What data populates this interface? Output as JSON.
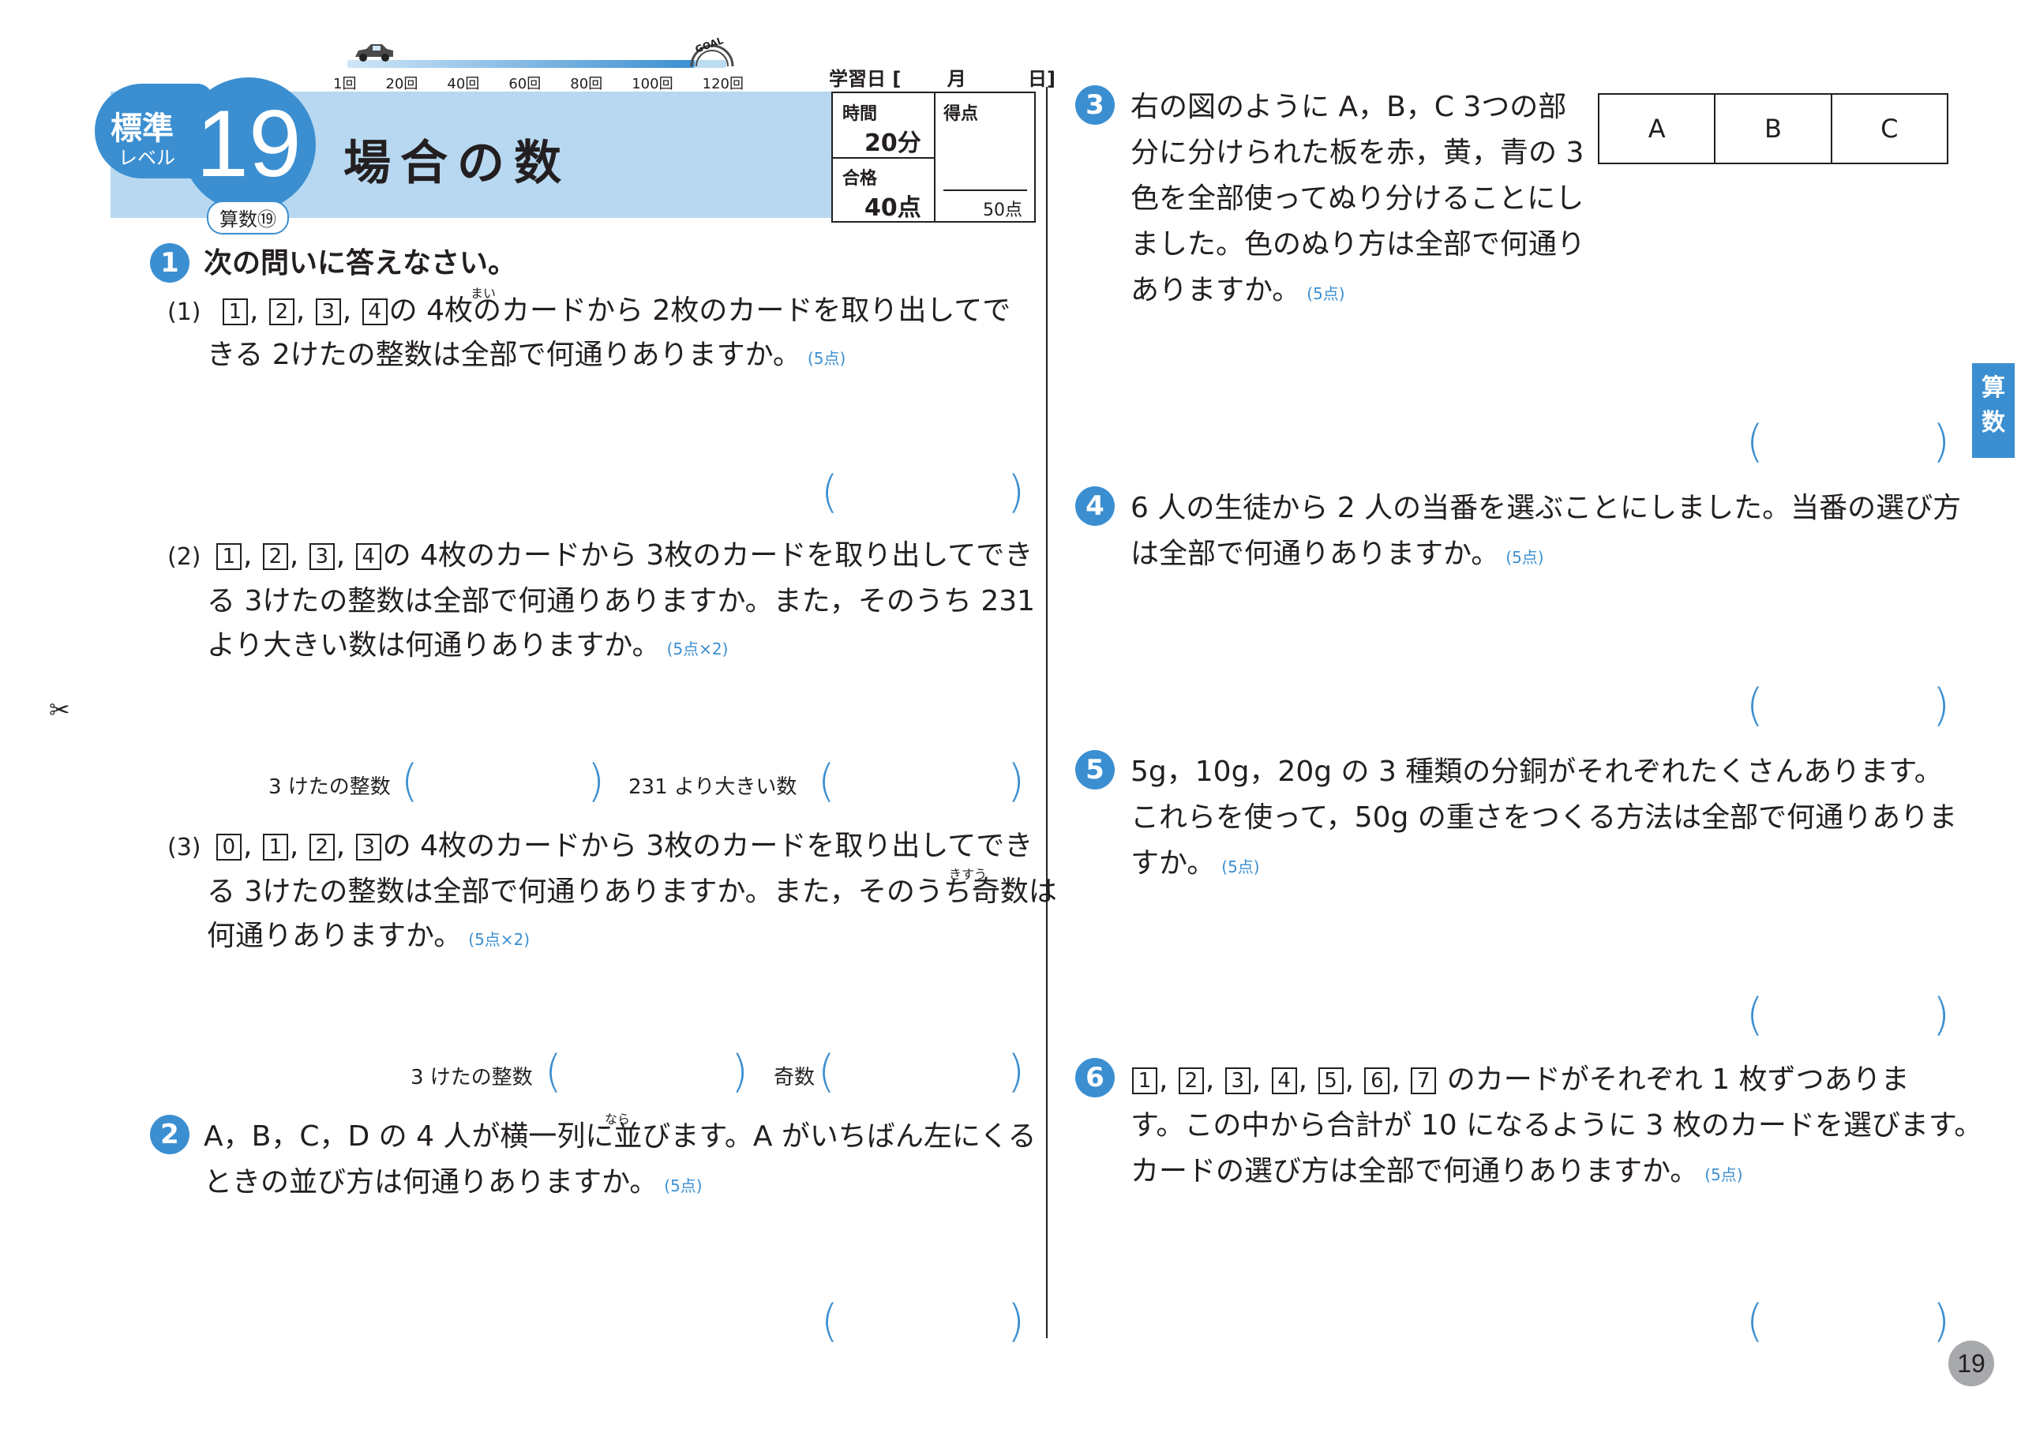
{
  "progress": {
    "ticks": [
      "1回",
      "20回",
      "40回",
      "60回",
      "80回",
      "100回",
      "120回"
    ],
    "goal": "GOAL"
  },
  "header": {
    "level_top": "標準",
    "level_bottom": "レベル",
    "number": "19",
    "title": "場合の数",
    "subject_tag": "算数⑲",
    "study_date_label": "学習日 [",
    "month_label": "月",
    "day_label": "日]",
    "time_label": "時間",
    "time_value": "20分",
    "pass_label": "合格",
    "pass_value": "40点",
    "score_label": "得点",
    "score_total": "50点"
  },
  "side_tab": {
    "line1": "算",
    "line2": "数"
  },
  "page_number": "19",
  "scissors": "✂",
  "q1": {
    "num": "1",
    "prompt": "次の問いに答えなさい。",
    "p1": {
      "label": "(1)",
      "cards": [
        "1",
        "2",
        "3",
        "4"
      ],
      "ruby": "まい",
      "line1_rest": "の 4枚のカードから 2枚のカードを取り出してで",
      "line2": "きる 2けたの整数は全部で何通りありますか。",
      "points": "(5点)"
    },
    "p2": {
      "label": "(2)",
      "cards": [
        "1",
        "2",
        "3",
        "4"
      ],
      "line1_rest": "の 4枚のカードから 3枚のカードを取り出してでき",
      "line2": "る 3けたの整数は全部で何通りありますか。また，そのうち 231",
      "line3": "より大きい数は何通りありますか。",
      "points": "(5点×2)",
      "ans1_label": "3 けたの整数",
      "ans2_label": "231 より大きい数"
    },
    "p3": {
      "label": "(3)",
      "cards": [
        "0",
        "1",
        "2",
        "3"
      ],
      "ruby": "きすう",
      "line1_rest": "の 4枚のカードから 3枚のカードを取り出してでき",
      "line2": "る 3けたの整数は全部で何通りありますか。また，そのうち奇数は",
      "line3": "何通りありますか。",
      "points": "(5点×2)",
      "ans1_label": "3 けたの整数",
      "ans2_label": "奇数"
    }
  },
  "q2": {
    "num": "2",
    "ruby": "なら",
    "line1": "A，B，C，D の 4 人が横一列に並びます。A がいちばん左にくる",
    "line2": "ときの並び方は何通りありますか。",
    "points": "(5点)"
  },
  "q3": {
    "num": "3",
    "lines": [
      "右の図のように A，B，C 3つの部",
      "分に分けられた板を赤，黄，青の 3",
      "色を全部使ってぬり分けることにし",
      "ました。色のぬり方は全部で何通り",
      "ありますか。"
    ],
    "points": "(5点)",
    "board": [
      "A",
      "B",
      "C"
    ]
  },
  "q4": {
    "num": "4",
    "line1": "6 人の生徒から 2 人の当番を選ぶことにしました。当番の選び方",
    "line2": "は全部で何通りありますか。",
    "points": "(5点)"
  },
  "q5": {
    "num": "5",
    "line1": "5g，10g，20g の 3 種類の分銅がそれぞれたくさんあります。",
    "line2": "これらを使って，50g の重さをつくる方法は全部で何通りありま",
    "line3": "すか。",
    "points": "(5点)"
  },
  "q6": {
    "num": "6",
    "cards": [
      "1",
      "2",
      "3",
      "4",
      "5",
      "6",
      "7"
    ],
    "line1_rest": "のカードがそれぞれ 1 枚ずつありま",
    "line2": "す。この中から合計が 10 になるように 3 枚のカードを選びます。",
    "line3": "カードの選び方は全部で何通りありますか。",
    "points": "(5点)"
  },
  "paren_open": "(",
  "paren_close": ")",
  "colors": {
    "accent": "#3b8fd1",
    "header_band": "#b7d8f0",
    "text": "#231f20"
  }
}
